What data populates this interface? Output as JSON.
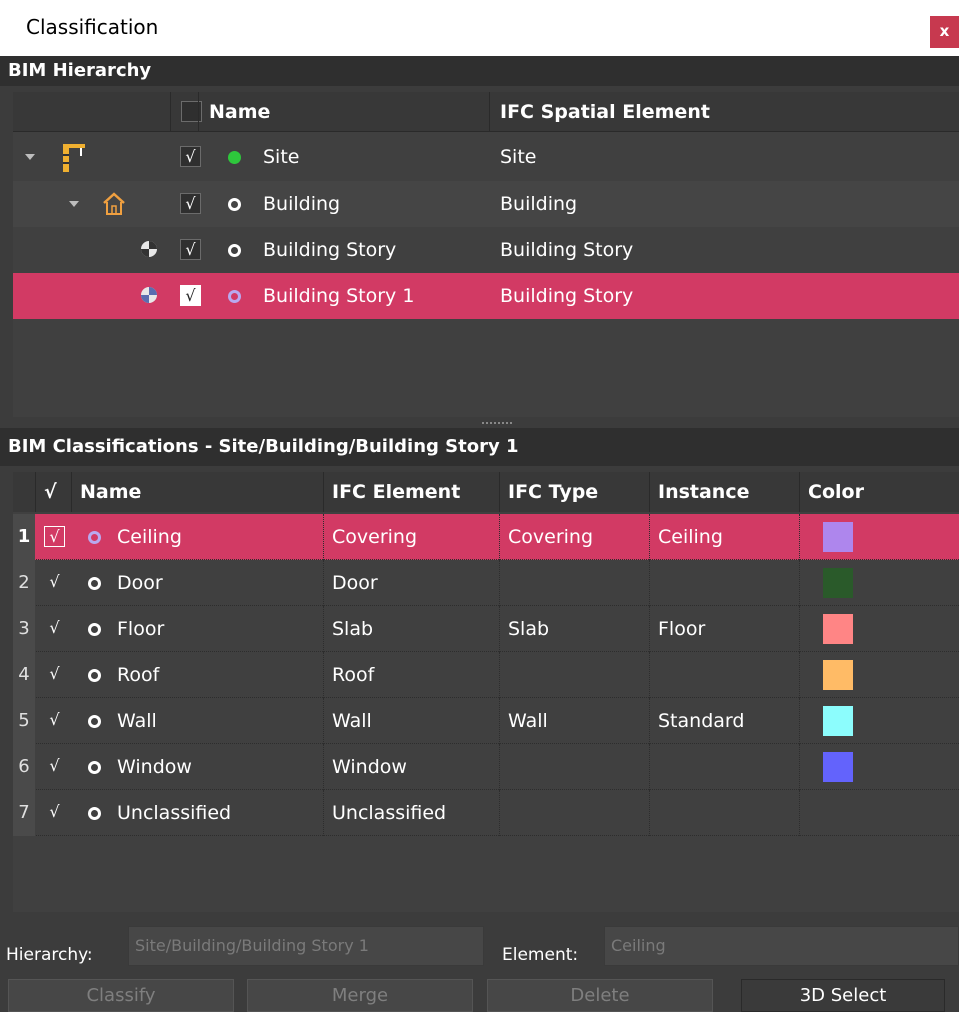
{
  "window": {
    "title": "Classification",
    "close_label": "x"
  },
  "hierarchy": {
    "header": "BIM Hierarchy",
    "columns": {
      "name": "Name",
      "spatial": "IFC Spatial Element"
    },
    "rows": [
      {
        "name": "Site",
        "element": "Site",
        "checked": "√",
        "icon": "crane-icon",
        "status": "green-dot"
      },
      {
        "name": "Building",
        "element": "Building",
        "checked": "√",
        "icon": "house-icon",
        "status": "ring"
      },
      {
        "name": "Building Story",
        "element": "Building Story",
        "checked": "√",
        "icon": "story-icon",
        "status": "ring"
      },
      {
        "name": "Building Story 1",
        "element": "Building Story",
        "checked": "√",
        "icon": "story-icon",
        "status": "ring",
        "selected": true
      }
    ]
  },
  "classifications": {
    "header": "BIM Classifications - Site/Building/Building Story 1",
    "columns": {
      "check": "√",
      "name": "Name",
      "ifc_element": "IFC Element",
      "ifc_type": "IFC Type",
      "instance": "Instance",
      "color": "Color"
    },
    "rows": [
      {
        "num": "1",
        "check": "√",
        "name": "Ceiling",
        "ifc_element": "Covering",
        "ifc_type": "Covering",
        "instance": "Ceiling",
        "color": "#ae86ed",
        "selected": true
      },
      {
        "num": "2",
        "check": "√",
        "name": "Door",
        "ifc_element": "Door",
        "ifc_type": "",
        "instance": "",
        "color": "#2a5a2a"
      },
      {
        "num": "3",
        "check": "√",
        "name": "Floor",
        "ifc_element": "Slab",
        "ifc_type": "Slab",
        "instance": "Floor",
        "color": "#ff8585"
      },
      {
        "num": "4",
        "check": "√",
        "name": "Roof",
        "ifc_element": "Roof",
        "ifc_type": "",
        "instance": "",
        "color": "#ffbb66"
      },
      {
        "num": "5",
        "check": "√",
        "name": "Wall",
        "ifc_element": "Wall",
        "ifc_type": "Wall",
        "instance": "Standard",
        "color": "#8cfdfd"
      },
      {
        "num": "6",
        "check": "√",
        "name": "Window",
        "ifc_element": "Window",
        "ifc_type": "",
        "instance": "",
        "color": "#6363fc"
      },
      {
        "num": "7",
        "check": "√",
        "name": "Unclassified",
        "ifc_element": "Unclassified",
        "ifc_type": "",
        "instance": "",
        "color": ""
      }
    ]
  },
  "fields": {
    "hierarchy_label": "Hierarchy:",
    "hierarchy_value": "Site/Building/Building Story 1",
    "element_label": "Element:",
    "element_value": "Ceiling"
  },
  "buttons": {
    "classify": "Classify",
    "merge": "Merge",
    "delete": "Delete",
    "select3d": "3D Select"
  }
}
